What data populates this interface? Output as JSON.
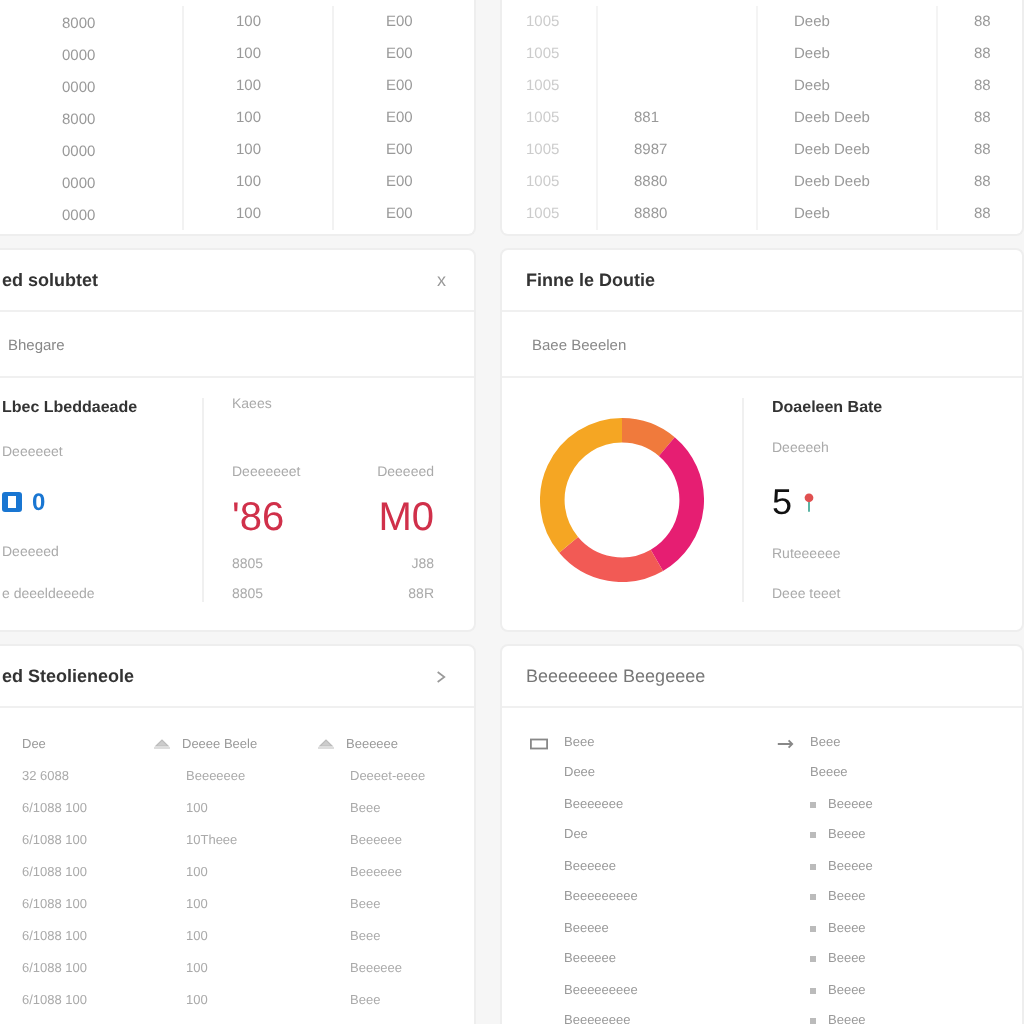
{
  "top_left_table": {
    "rows": [
      {
        "c1": "8000",
        "c2": "100",
        "c3": "E00"
      },
      {
        "c1": "0000",
        "c2": "100",
        "c3": "E00"
      },
      {
        "c1": "0000",
        "c2": "100",
        "c3": "E00"
      },
      {
        "c1": "8000",
        "c2": "100",
        "c3": "E00"
      },
      {
        "c1": "0000",
        "c2": "100",
        "c3": "E00"
      },
      {
        "c1": "0000",
        "c2": "100",
        "c3": "E00"
      },
      {
        "c1": "0000",
        "c2": "100",
        "c3": "E00"
      }
    ]
  },
  "top_right_table": {
    "rows": [
      {
        "c1": "1005",
        "c3": "Deeb",
        "c4": "88"
      },
      {
        "c1": "1005",
        "c3": "Deeb",
        "c4": "88"
      },
      {
        "c1": "1005",
        "c3": "Deeb",
        "c4": "88"
      },
      {
        "c1": "1005",
        "c2": "881",
        "c3": "Deeb Deeb",
        "c4": "88"
      },
      {
        "c1": "1005",
        "c2": "8987",
        "c3": "Deeb Deeb",
        "c4": "88"
      },
      {
        "c1": "1005",
        "c2": "8880",
        "c3": "Deeb Deeb",
        "c4": "88"
      },
      {
        "c1": "1005",
        "c2": "8880",
        "c3": "Deeb",
        "c4": "88"
      }
    ]
  },
  "summary_card": {
    "title": "ed solubtet",
    "close": "x",
    "subtitle": "Bhegare",
    "left": {
      "heading": "Lbec Lbeddaeade",
      "label": "Deeeeeet",
      "value": "0",
      "caption": "Deeeeed",
      "note": "e deeeldeeede"
    },
    "right": {
      "heading": "Kaees",
      "columns": [
        {
          "label": "Deeeeeeet",
          "value": "'86",
          "line_1": "8805",
          "line_2": "8805"
        },
        {
          "label": "Deeeeed",
          "value": "M0",
          "line_1": "J88",
          "line_2": "88R"
        }
      ]
    }
  },
  "chart_card": {
    "title": "Finne le Doutie",
    "subtitle": "Baee Beeelen",
    "heading": "Doaeleen Bate",
    "label": "Deeeeeh",
    "value": "5",
    "caption": "Ruteeeeee",
    "note": "Deee teeet"
  },
  "log_card": {
    "title": "ed Steolieneole",
    "columns": [
      "Dee",
      "Deeee Beele",
      "Beeeeee"
    ],
    "rows": [
      [
        "32 6088",
        "Beeeeeee",
        "Deeeet-eeee"
      ],
      [
        "6/1088 100",
        "100",
        "Beee"
      ],
      [
        "6/1088 100",
        "10Theee",
        "Beeeeee"
      ],
      [
        "6/1088 100",
        "100",
        "Beeeeee"
      ],
      [
        "6/1088 100",
        "100",
        "Beee"
      ],
      [
        "6/1088 100",
        "100",
        "Beee"
      ],
      [
        "6/1088 100",
        "100",
        "Beeeeee"
      ],
      [
        "6/1088 100",
        "100",
        "Beee"
      ]
    ]
  },
  "list_card": {
    "title": "Beeeeeeee Beegeeee",
    "left": {
      "heading": "Beee",
      "items": [
        "Deee",
        "Beeeeeee",
        "Dee",
        "Beeeeee",
        "Beeeeeeeee",
        "Beeeee",
        "Beeeeee",
        "Beeeeeeeee",
        "Beeeeeeee"
      ]
    },
    "right": {
      "heading": "Beee",
      "items": [
        "Beeee",
        "Beeeee",
        "Beeee",
        "Beeeee",
        "Beeee",
        "Beeee",
        "Beeee",
        "Beeee",
        "Beeee"
      ]
    }
  }
}
